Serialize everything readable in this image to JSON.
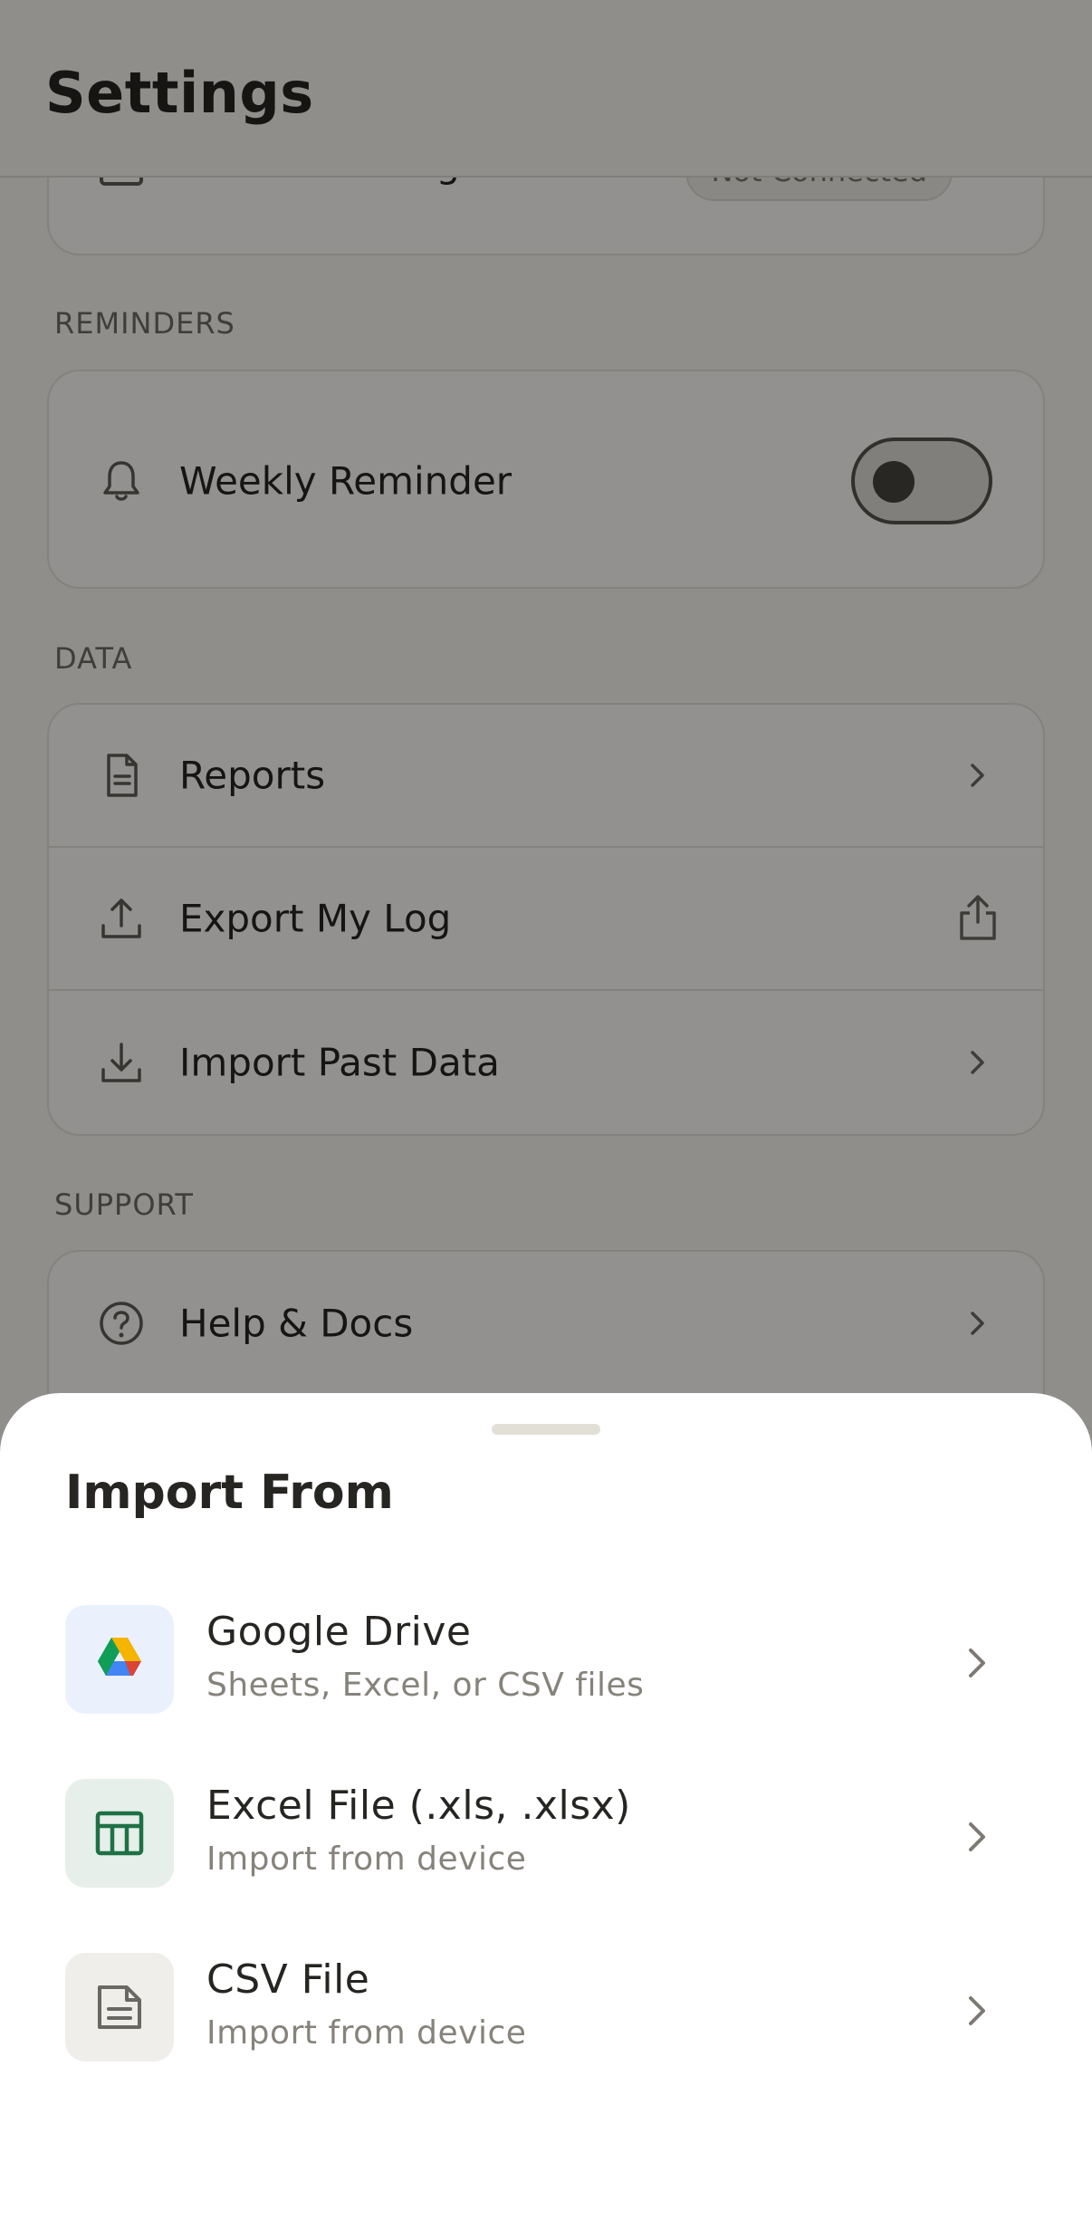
{
  "header": {
    "title": "Settings"
  },
  "calendar": {
    "label": "Calendar Integration",
    "status": "Not Connected"
  },
  "reminders": {
    "section_label": "REMINDERS",
    "weekly_reminder_label": "Weekly Reminder",
    "weekly_reminder_on": false
  },
  "data_section": {
    "section_label": "DATA",
    "items": [
      {
        "label": "Reports",
        "icon": "document-icon",
        "action": "chevron"
      },
      {
        "label": "Export My Log",
        "icon": "upload-icon",
        "action": "share"
      },
      {
        "label": "Import Past Data",
        "icon": "download-icon",
        "action": "chevron"
      }
    ]
  },
  "support": {
    "section_label": "SUPPORT",
    "items": [
      {
        "label": "Help & Docs",
        "icon": "help-circle-icon"
      }
    ]
  },
  "import_sheet": {
    "title": "Import From",
    "options": [
      {
        "title": "Google Drive",
        "subtitle": "Sheets, Excel, or CSV files",
        "icon": "google-drive-icon",
        "tile_color": "#ebf1fc"
      },
      {
        "title": "Excel File (.xls, .xlsx)",
        "subtitle": "Import from device",
        "icon": "spreadsheet-icon",
        "tile_color": "#e6efe9"
      },
      {
        "title": "CSV File",
        "subtitle": "Import from device",
        "icon": "document-icon",
        "tile_color": "#efeeeb"
      }
    ]
  }
}
